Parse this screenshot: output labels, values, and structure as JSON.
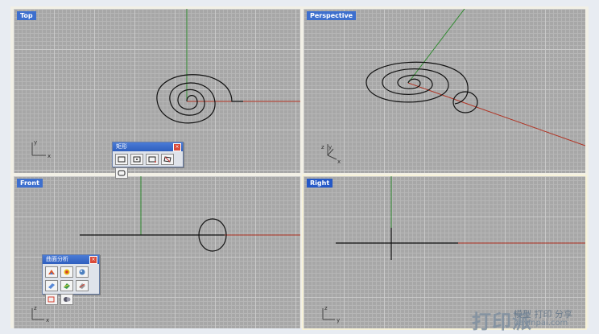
{
  "viewports": {
    "top": {
      "title": "Top"
    },
    "perspective": {
      "title": "Perspective"
    },
    "front": {
      "title": "Front"
    },
    "right": {
      "title": "Right"
    }
  },
  "axis_labels": {
    "x": "x",
    "y": "y",
    "z": "z"
  },
  "toolbars": {
    "rectangle": {
      "title": "矩形",
      "close_icon": "close-icon",
      "buttons": [
        "rectangle-corner-icon",
        "rectangle-center-icon",
        "rectangle-3pt-icon",
        "rectangle-vertical-icon",
        "rectangle-rounded-icon"
      ]
    },
    "surface_analysis": {
      "title": "曲面分析",
      "close_icon": "close-icon",
      "buttons": [
        "curvature-analysis-icon",
        "zebra-analysis-icon",
        "environment-map-icon",
        "draft-angle-icon",
        "emap-icon",
        "thickness-icon",
        "edge-analysis-icon",
        "analysis-off-icon"
      ]
    }
  },
  "watermark": {
    "logo": "打印派",
    "line1": "模型 打印 分享",
    "line2": "dayinpai.com"
  },
  "colors": {
    "viewport_bg": "#a7a7a7",
    "grid_major": "#c9c9c9",
    "axis_x": "#b03020",
    "axis_y": "#2f8a2f",
    "curve": "#111111",
    "title_tab": "#3d6fce"
  }
}
